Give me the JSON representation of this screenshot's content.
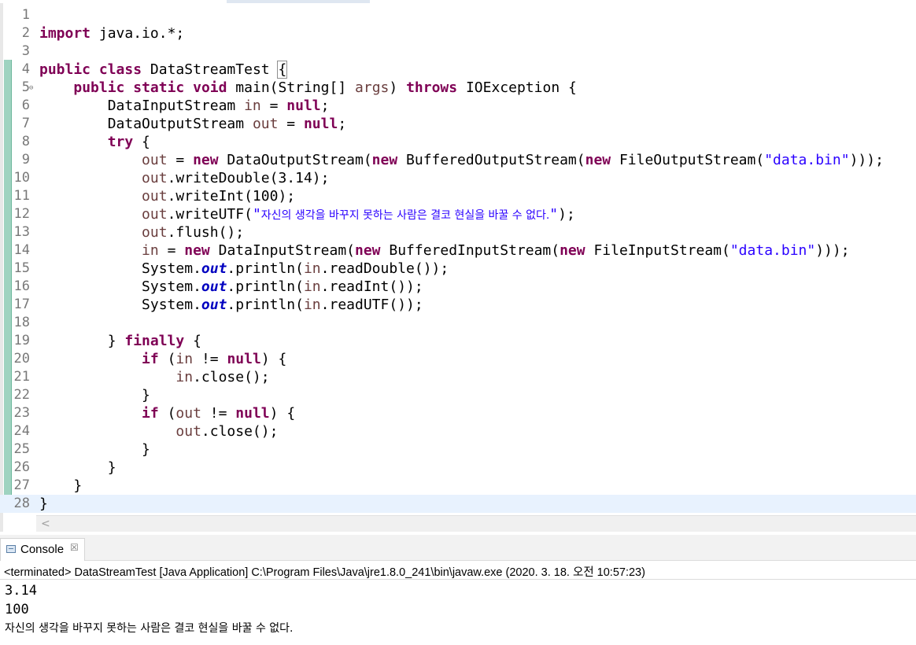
{
  "editor": {
    "lines": [
      {
        "n": "1",
        "segs": []
      },
      {
        "n": "2",
        "segs": [
          {
            "t": "import",
            "c": "kw"
          },
          {
            "t": " java.io.*;",
            "c": ""
          }
        ]
      },
      {
        "n": "3",
        "segs": []
      },
      {
        "n": "4",
        "segs": [
          {
            "t": "public",
            "c": "kw"
          },
          {
            "t": " ",
            "c": ""
          },
          {
            "t": "class",
            "c": "kw"
          },
          {
            "t": " DataStreamTest ",
            "c": ""
          },
          {
            "t": "{",
            "c": "brace-hl"
          }
        ]
      },
      {
        "n": "5",
        "fold": true,
        "segs": [
          {
            "t": "    ",
            "c": ""
          },
          {
            "t": "public",
            "c": "kw"
          },
          {
            "t": " ",
            "c": ""
          },
          {
            "t": "static",
            "c": "kw"
          },
          {
            "t": " ",
            "c": ""
          },
          {
            "t": "void",
            "c": "kw"
          },
          {
            "t": " main(String[] ",
            "c": ""
          },
          {
            "t": "args",
            "c": "var"
          },
          {
            "t": ") ",
            "c": ""
          },
          {
            "t": "throws",
            "c": "kw"
          },
          {
            "t": " IOException {",
            "c": ""
          }
        ]
      },
      {
        "n": "6",
        "segs": [
          {
            "t": "        DataInputStream ",
            "c": ""
          },
          {
            "t": "in",
            "c": "var"
          },
          {
            "t": " = ",
            "c": ""
          },
          {
            "t": "null",
            "c": "kw"
          },
          {
            "t": ";",
            "c": ""
          }
        ]
      },
      {
        "n": "7",
        "segs": [
          {
            "t": "        DataOutputStream ",
            "c": ""
          },
          {
            "t": "out",
            "c": "var"
          },
          {
            "t": " = ",
            "c": ""
          },
          {
            "t": "null",
            "c": "kw"
          },
          {
            "t": ";",
            "c": ""
          }
        ]
      },
      {
        "n": "8",
        "segs": [
          {
            "t": "        ",
            "c": ""
          },
          {
            "t": "try",
            "c": "kw"
          },
          {
            "t": " {",
            "c": ""
          }
        ]
      },
      {
        "n": "9",
        "segs": [
          {
            "t": "            ",
            "c": ""
          },
          {
            "t": "out",
            "c": "var"
          },
          {
            "t": " = ",
            "c": ""
          },
          {
            "t": "new",
            "c": "kw"
          },
          {
            "t": " DataOutputStream(",
            "c": ""
          },
          {
            "t": "new",
            "c": "kw"
          },
          {
            "t": " BufferedOutputStream(",
            "c": ""
          },
          {
            "t": "new",
            "c": "kw"
          },
          {
            "t": " FileOutputStream(",
            "c": ""
          },
          {
            "t": "\"data.bin\"",
            "c": "str"
          },
          {
            "t": ")));",
            "c": ""
          }
        ]
      },
      {
        "n": "10",
        "segs": [
          {
            "t": "            ",
            "c": ""
          },
          {
            "t": "out",
            "c": "var"
          },
          {
            "t": ".writeDouble(3.14);",
            "c": ""
          }
        ]
      },
      {
        "n": "11",
        "segs": [
          {
            "t": "            ",
            "c": ""
          },
          {
            "t": "out",
            "c": "var"
          },
          {
            "t": ".writeInt(100);",
            "c": ""
          }
        ]
      },
      {
        "n": "12",
        "segs": [
          {
            "t": "            ",
            "c": ""
          },
          {
            "t": "out",
            "c": "var"
          },
          {
            "t": ".writeUTF(",
            "c": ""
          },
          {
            "t": "\"",
            "c": "str"
          },
          {
            "t": "자신의 생각을 바꾸지 못하는 사람은 결코 현실을 바꿀 수 없다.",
            "c": "korstr"
          },
          {
            "t": "\"",
            "c": "str"
          },
          {
            "t": ");",
            "c": ""
          }
        ]
      },
      {
        "n": "13",
        "segs": [
          {
            "t": "            ",
            "c": ""
          },
          {
            "t": "out",
            "c": "var"
          },
          {
            "t": ".flush();",
            "c": ""
          }
        ]
      },
      {
        "n": "14",
        "segs": [
          {
            "t": "            ",
            "c": ""
          },
          {
            "t": "in",
            "c": "var"
          },
          {
            "t": " = ",
            "c": ""
          },
          {
            "t": "new",
            "c": "kw"
          },
          {
            "t": " DataInputStream(",
            "c": ""
          },
          {
            "t": "new",
            "c": "kw"
          },
          {
            "t": " BufferedInputStream(",
            "c": ""
          },
          {
            "t": "new",
            "c": "kw"
          },
          {
            "t": " FileInputStream(",
            "c": ""
          },
          {
            "t": "\"data.bin\"",
            "c": "str"
          },
          {
            "t": ")));",
            "c": ""
          }
        ]
      },
      {
        "n": "15",
        "segs": [
          {
            "t": "            System.",
            "c": ""
          },
          {
            "t": "out",
            "c": "fld"
          },
          {
            "t": ".println(",
            "c": ""
          },
          {
            "t": "in",
            "c": "var"
          },
          {
            "t": ".readDouble());",
            "c": ""
          }
        ]
      },
      {
        "n": "16",
        "segs": [
          {
            "t": "            System.",
            "c": ""
          },
          {
            "t": "out",
            "c": "fld"
          },
          {
            "t": ".println(",
            "c": ""
          },
          {
            "t": "in",
            "c": "var"
          },
          {
            "t": ".readInt());",
            "c": ""
          }
        ]
      },
      {
        "n": "17",
        "segs": [
          {
            "t": "            System.",
            "c": ""
          },
          {
            "t": "out",
            "c": "fld"
          },
          {
            "t": ".println(",
            "c": ""
          },
          {
            "t": "in",
            "c": "var"
          },
          {
            "t": ".readUTF());",
            "c": ""
          }
        ]
      },
      {
        "n": "18",
        "segs": []
      },
      {
        "n": "19",
        "segs": [
          {
            "t": "        } ",
            "c": ""
          },
          {
            "t": "finally",
            "c": "kw"
          },
          {
            "t": " {",
            "c": ""
          }
        ]
      },
      {
        "n": "20",
        "segs": [
          {
            "t": "            ",
            "c": ""
          },
          {
            "t": "if",
            "c": "kw"
          },
          {
            "t": " (",
            "c": ""
          },
          {
            "t": "in",
            "c": "var"
          },
          {
            "t": " != ",
            "c": ""
          },
          {
            "t": "null",
            "c": "kw"
          },
          {
            "t": ") {",
            "c": ""
          }
        ]
      },
      {
        "n": "21",
        "segs": [
          {
            "t": "                ",
            "c": ""
          },
          {
            "t": "in",
            "c": "var"
          },
          {
            "t": ".close();",
            "c": ""
          }
        ]
      },
      {
        "n": "22",
        "segs": [
          {
            "t": "            }",
            "c": ""
          }
        ]
      },
      {
        "n": "23",
        "segs": [
          {
            "t": "            ",
            "c": ""
          },
          {
            "t": "if",
            "c": "kw"
          },
          {
            "t": " (",
            "c": ""
          },
          {
            "t": "out",
            "c": "var"
          },
          {
            "t": " != ",
            "c": ""
          },
          {
            "t": "null",
            "c": "kw"
          },
          {
            "t": ") {",
            "c": ""
          }
        ]
      },
      {
        "n": "24",
        "segs": [
          {
            "t": "                ",
            "c": ""
          },
          {
            "t": "out",
            "c": "var"
          },
          {
            "t": ".close();",
            "c": ""
          }
        ]
      },
      {
        "n": "25",
        "segs": [
          {
            "t": "            }",
            "c": ""
          }
        ]
      },
      {
        "n": "26",
        "segs": [
          {
            "t": "        }",
            "c": ""
          }
        ]
      },
      {
        "n": "27",
        "segs": [
          {
            "t": "    }",
            "c": ""
          }
        ]
      },
      {
        "n": "28",
        "current": true,
        "segs": [
          {
            "t": "}",
            "c": ""
          }
        ]
      }
    ],
    "hscroll_left_arrow": "<"
  },
  "console": {
    "tab_label": "Console",
    "tab_close": "☒",
    "status": "<terminated> DataStreamTest [Java Application] C:\\Program Files\\Java\\jre1.8.0_241\\bin\\javaw.exe (2020. 3. 18. 오전 10:57:23)",
    "output": [
      "3.14",
      "100",
      "자신의 생각을 바꾸지 못하는 사람은 결코 현실을 바꿀 수 없다."
    ]
  },
  "colors": {
    "keyword": "#7f0055",
    "string": "#2a00ff",
    "local_variable": "#6a3e3e",
    "static_field": "#0000c0",
    "current_line": "#e8f2fe",
    "change_bar": "#9fd3c0"
  },
  "icons": {
    "console_tab": "console-icon",
    "fold_marker": "minus-fold-icon"
  }
}
